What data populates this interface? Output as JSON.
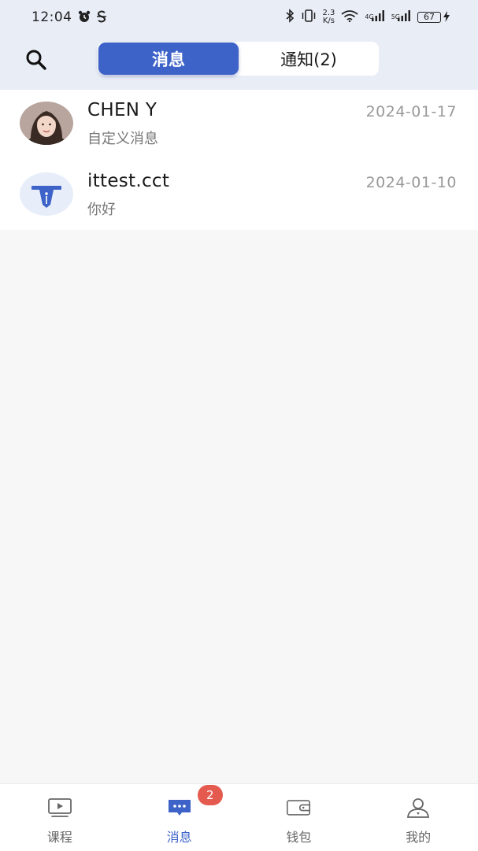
{
  "status_bar": {
    "time": "12:04",
    "net_speed_value": "2.3",
    "net_speed_unit": "K/s",
    "net_tag_1": "4G",
    "net_tag_2": "5G",
    "battery": "67",
    "icons": [
      "alarm-icon",
      "s-app-icon",
      "bluetooth-icon",
      "vibrate-icon",
      "wifi-icon",
      "signal-icon",
      "signal-icon",
      "charging-icon"
    ]
  },
  "header": {
    "search_icon": "search-icon",
    "tabs": [
      {
        "label": "消息",
        "active": true
      },
      {
        "label": "通知(2)",
        "active": false
      }
    ]
  },
  "messages": [
    {
      "name": "CHEN Y",
      "preview": "自定义消息",
      "date": "2024-01-17",
      "avatar": "photo-avatar"
    },
    {
      "name": "ittest.cct",
      "preview": "你好",
      "date": "2024-01-10",
      "avatar": "school-logo-avatar"
    }
  ],
  "bottom_nav": {
    "items": [
      {
        "label": "课程",
        "icon": "video-icon",
        "active": false
      },
      {
        "label": "消息",
        "icon": "chat-icon",
        "active": true,
        "badge": "2"
      },
      {
        "label": "钱包",
        "icon": "wallet-icon",
        "active": false
      },
      {
        "label": "我的",
        "icon": "user-icon",
        "active": false
      }
    ]
  },
  "colors": {
    "accent": "#3d63c9",
    "badge": "#e55a4e",
    "header_bg": "#e9edf6",
    "page_bg": "#f7f7f8"
  }
}
